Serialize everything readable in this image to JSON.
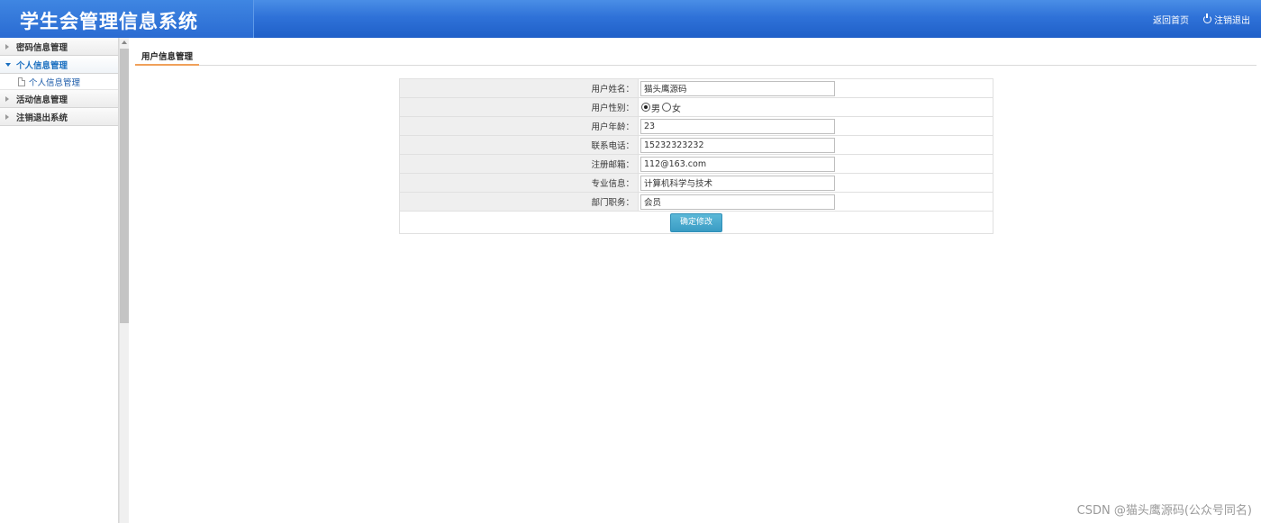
{
  "header": {
    "app_title": "学生会管理信息系统",
    "home_link": "返回首页",
    "logout_link": "注销退出"
  },
  "sidebar": {
    "items": [
      {
        "label": "密码信息管理",
        "expanded": false
      },
      {
        "label": "个人信息管理",
        "expanded": true,
        "children": [
          {
            "label": "个人信息管理"
          }
        ]
      },
      {
        "label": "活动信息管理",
        "expanded": false
      },
      {
        "label": "注销退出系统",
        "expanded": false
      }
    ]
  },
  "tab": {
    "label": "用户信息管理"
  },
  "form": {
    "name_label": "用户姓名：",
    "name_value": "猫头鹰源码",
    "gender_label": "用户性别：",
    "gender_male": "男",
    "gender_female": "女",
    "gender_selected": "男",
    "age_label": "用户年龄：",
    "age_value": "23",
    "phone_label": "联系电话：",
    "phone_value": "15232323232",
    "email_label": "注册邮箱：",
    "email_value": "112@163.com",
    "major_label": "专业信息：",
    "major_value": "计算机科学与技术",
    "position_label": "部门职务：",
    "position_value": "会员",
    "submit_label": "确定修改"
  },
  "watermark": "CSDN @猫头鹰源码(公众号同名)"
}
